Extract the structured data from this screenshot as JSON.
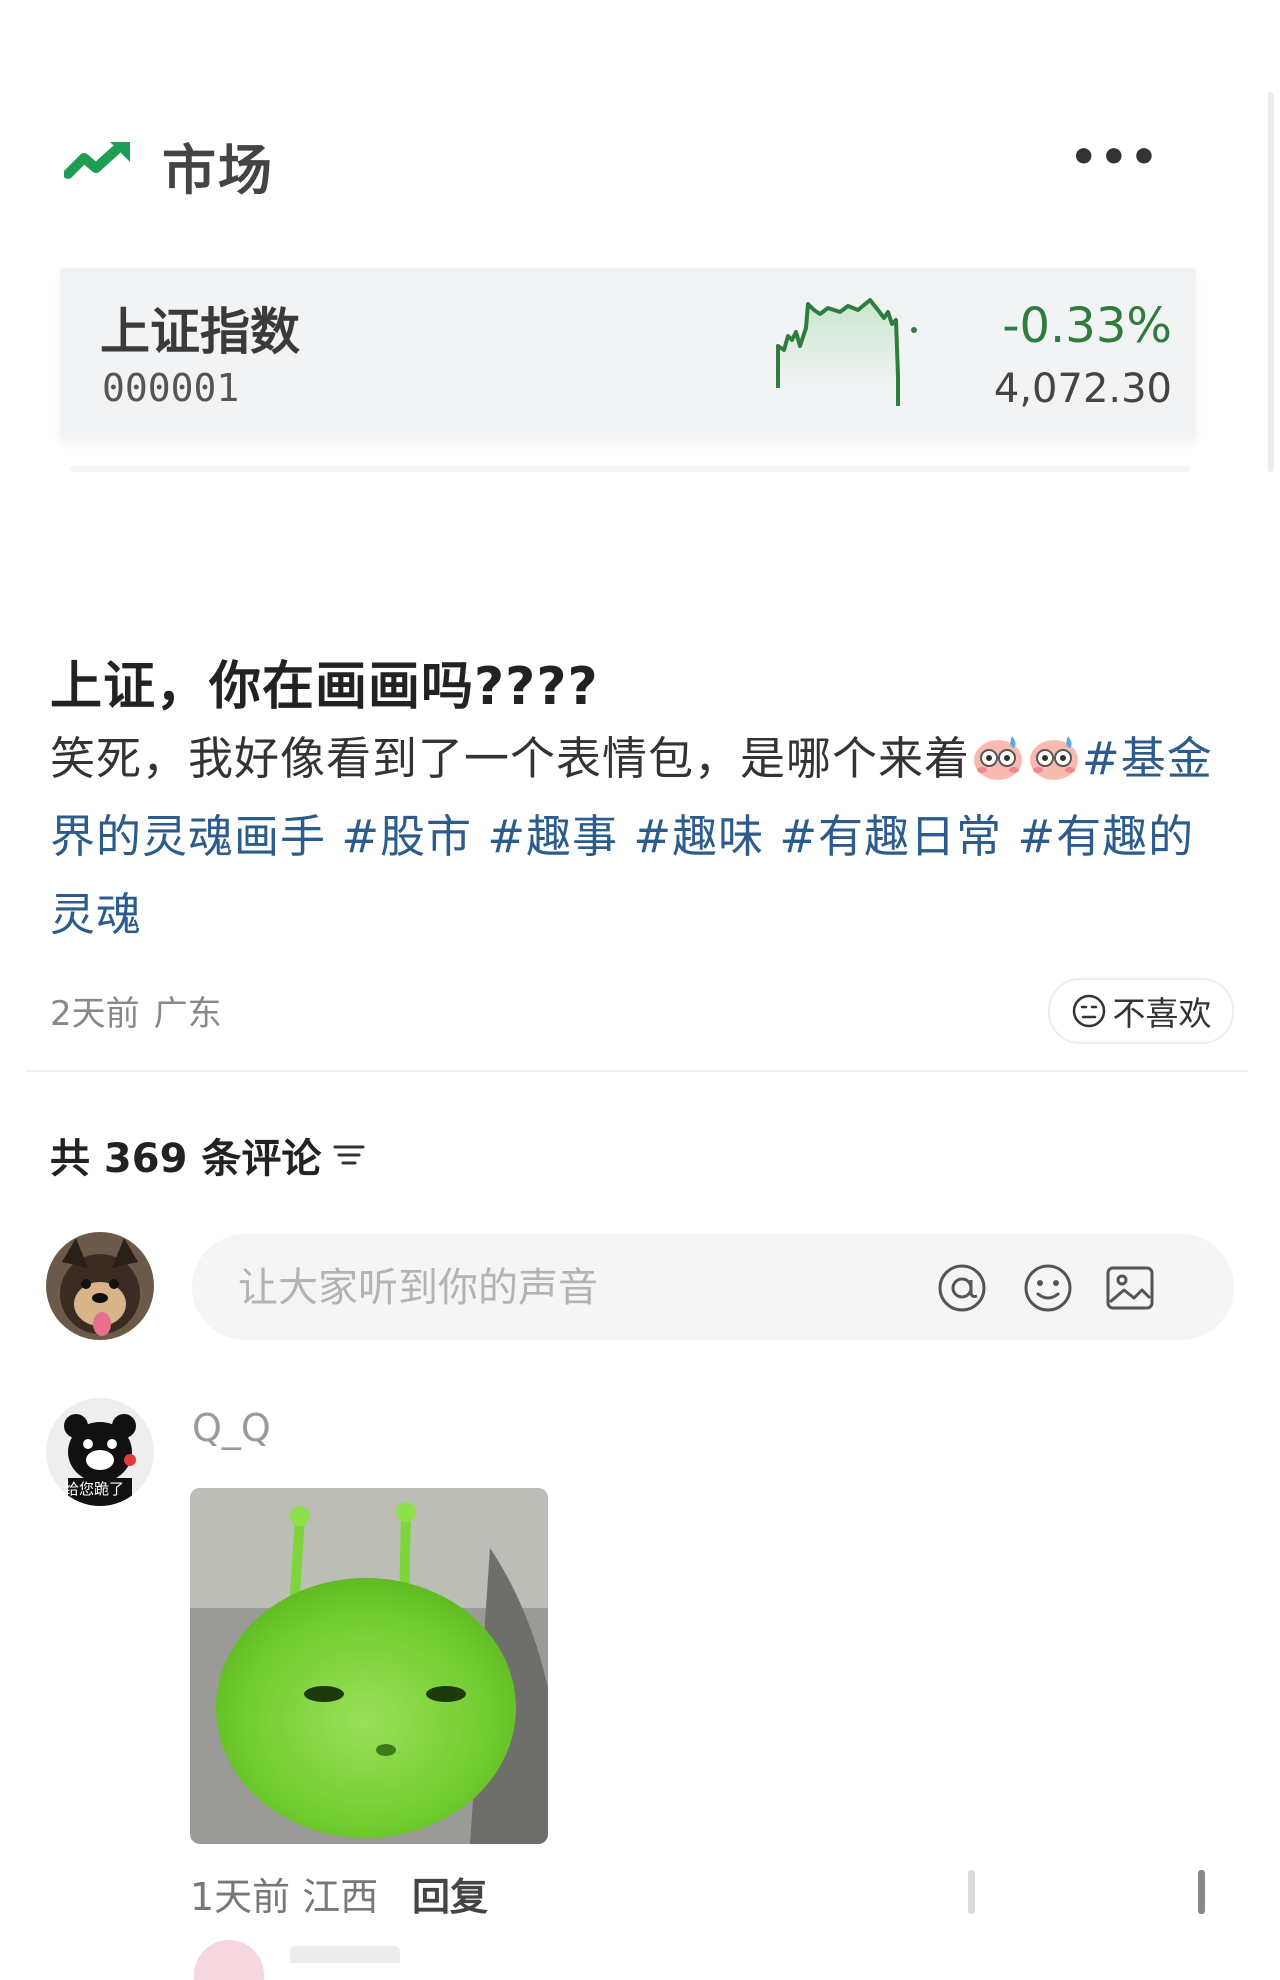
{
  "market": {
    "title": "市场",
    "more_label": "•••",
    "index_name": "上证指数",
    "index_code": "000001",
    "change_pct": "-0.33%",
    "price": "4,072.30",
    "accent_color": "#2e7d3e"
  },
  "post": {
    "title": "上证，你在画画吗????",
    "body_text": "笑死，我好像看到了一个表情包，是哪个来着",
    "emoji_name": "blushing-sweat-emoji",
    "hashtags": [
      "#基金界的灵魂画手",
      "#股市",
      "#趣事",
      "#趣味",
      "#有趣日常",
      "#有趣的灵魂"
    ],
    "time": "2天前",
    "location": "广东",
    "dislike_label": "不喜欢",
    "hashtag_color": "#2b5c8c"
  },
  "comments": {
    "count_label": "共 369 条评论",
    "input_placeholder": "让大家听到你的声音",
    "icons": [
      "at-icon",
      "emoji-icon",
      "image-icon"
    ],
    "items": [
      {
        "username": "Q_Q",
        "avatar_caption": "给您跪了",
        "image_subject": "green-cat-meme",
        "time": "1天前",
        "location": "江西",
        "reply_label": "回复"
      }
    ]
  }
}
